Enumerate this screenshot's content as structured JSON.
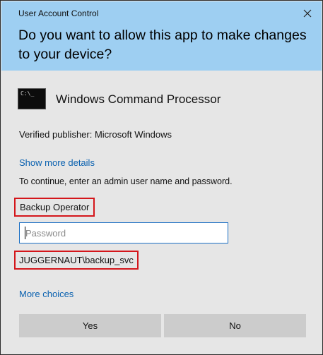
{
  "window": {
    "title": "User Account Control",
    "close_icon": "close-icon",
    "header_color": "#9ecff2"
  },
  "prompt": {
    "question": "Do you want to allow this app to make changes to your device?"
  },
  "app": {
    "icon": "command-prompt-icon",
    "icon_text": "C:\\_",
    "name": "Windows Command Processor",
    "publisher": "Verified publisher: Microsoft Windows"
  },
  "links": {
    "show_details": "Show more details",
    "more_choices": "More choices"
  },
  "credentials": {
    "instruction": "To continue, enter an admin user name and password.",
    "username": "Backup Operator",
    "password_placeholder": "Password",
    "password_value": "",
    "account": "JUGGERNAUT\\backup_svc"
  },
  "buttons": {
    "yes": "Yes",
    "no": "No"
  },
  "colors": {
    "link": "#0b62b0",
    "highlight_border": "#d4161b",
    "input_border": "#1a6fc4"
  }
}
